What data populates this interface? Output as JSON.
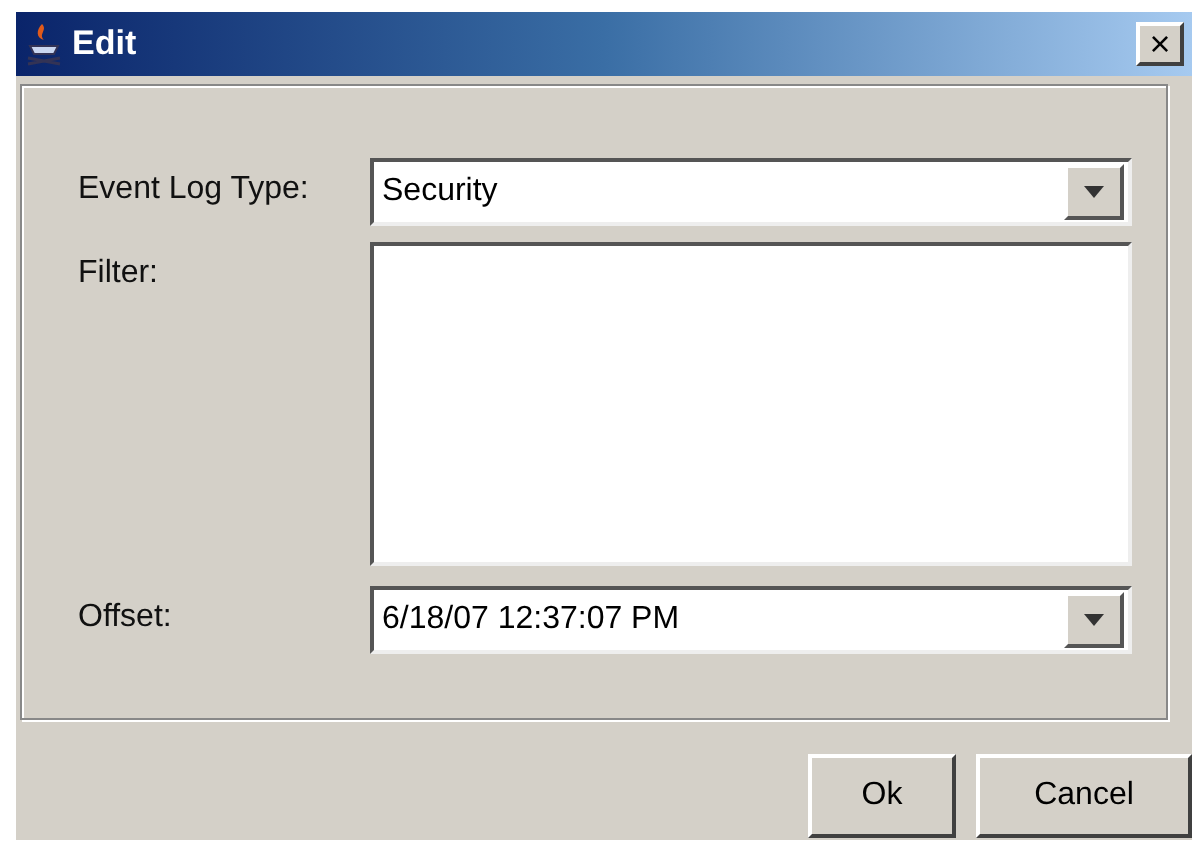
{
  "window": {
    "title": "Edit",
    "close": "×"
  },
  "fields": [
    {
      "kind": "combo",
      "label": "Event Log Type:",
      "value": "Security"
    },
    {
      "kind": "textarea",
      "label": "Filter:"
    },
    {
      "kind": "combo",
      "label": "Offset:",
      "value": "6/18/07 12:37:07 PM"
    }
  ],
  "buttons": [
    "Ok",
    "Cancel"
  ]
}
